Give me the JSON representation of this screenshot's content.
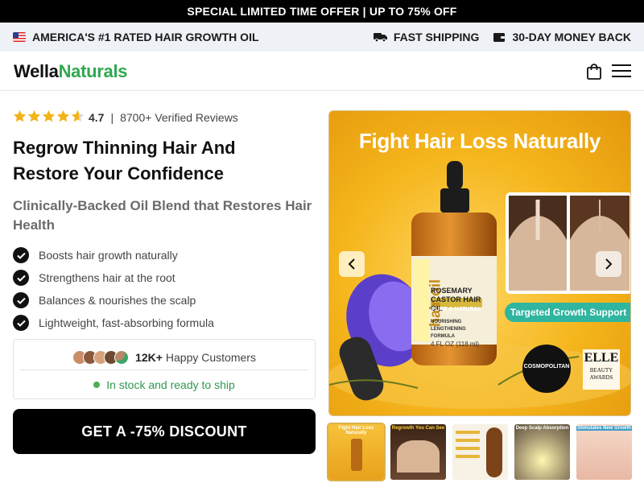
{
  "promo_bar": {
    "text": "SPECIAL LIMITED TIME OFFER | UP TO 75% OFF"
  },
  "info_bar": {
    "left_text": "AMERICA'S #1 RATED HAIR GROWTH OIL",
    "shipping": "FAST SHIPPING",
    "guarantee": "30-DAY MONEY BACK"
  },
  "header": {
    "logo_part1": "Wella",
    "logo_part2": "Naturals",
    "icons": [
      "shopping-bag-icon",
      "hamburger-menu-icon"
    ]
  },
  "product": {
    "rating": "4.7",
    "rating_stars": 4.7,
    "separator": "|",
    "reviews": "8700+ Verified Reviews",
    "title": "Regrow Thinning Hair And Restore Your Confidence",
    "subtitle": "Clinically-Backed Oil Blend that Restores Hair Health",
    "benefits": [
      "Boosts hair growth naturally",
      "Strengthens hair at the root",
      "Balances & nourishes the scalp",
      "Lightweight, fast-absorbing formula"
    ],
    "customers_count": "12K+",
    "customers_label": "Happy Customers",
    "stock": "In stock and ready to ship",
    "cta": "GET A -75% DISCOUNT"
  },
  "gallery": {
    "hero_title": "Fight Hair Loss Naturally",
    "bottle_side_text": "hair oil",
    "bottle_name": "ROSEMARY CASTOR HAIR OIL",
    "bottle_badge": "PURE & NATURAL",
    "bottle_desc": "NOURISHING LENGTHENING FORMULA",
    "bottle_volume": "4 FL OZ (118 ml)",
    "badge": "Targeted Growth Support",
    "press": [
      "COSMOPOLITAN",
      "ELLE"
    ],
    "elle_sub": "BEAUTY AWARDS",
    "thumbnails": [
      "Fight Hair Loss Naturally",
      "Regrowth You Can See",
      "",
      "Deep Scalp Absorption",
      "Stimulates New Growth"
    ],
    "colors": {
      "accent": "#f3b21a",
      "teal": "#2fb5a0",
      "brand_green": "#2fa84f"
    }
  }
}
